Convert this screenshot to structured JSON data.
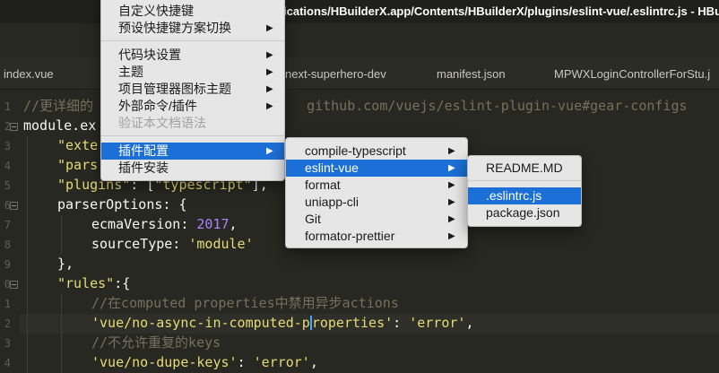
{
  "window": {
    "title": "...Applications/HBuilderX.app/Contents/HBuilderX/plugins/eslint-vue/.eslintrc.js - HBuilderX",
    "title_visible": "ications/HBuilderX.app/Contents/HBuilderX/plugins/eslint-vue/.eslintrc.js - HBuild"
  },
  "tabs": [
    {
      "label": "index.vue"
    },
    {
      "label": "next-superhero-dev"
    },
    {
      "label": "manifest.json"
    },
    {
      "label": "MPWXLoginControllerForStu.j"
    }
  ],
  "gutter": {
    "line_numbers": [
      "1",
      "2",
      "3",
      "4",
      "5",
      "6",
      "7",
      "8",
      "9",
      "0",
      "1",
      "2",
      "3",
      "4"
    ]
  },
  "code": {
    "l1_comment": "//更详细的",
    "l1_rest": "github.com/vuejs/eslint-plugin-vue#gear-configs",
    "l2_start": "module.ex",
    "l3_str": "\"exte",
    "l4_str": "\"pars",
    "l5_key": "\"plugins\"",
    "l5_colon": ": [",
    "l5_val": "\"typescript\"",
    "l5_end": "],",
    "l6": "parserOptions: {",
    "l7_key": "ecmaVersion: ",
    "l7_num": "2017",
    "l7_end": ",",
    "l8_key": "sourceType: ",
    "l8_str": "'module'",
    "l9": "},",
    "l10_key": "\"rules\"",
    "l10_end": ":{",
    "l11_comment": "//在computed properties中禁用异步actions",
    "l12_str_a": "'vue/no-async-in-computed-p",
    "l12_str_b": "roperties'",
    "l12_mid": ": ",
    "l12_val": "'error'",
    "l12_end": ",",
    "l13_comment": "//不允许重复的keys",
    "l14_str": "'vue/no-dupe-keys'",
    "l14_mid": ": ",
    "l14_val": "'error'",
    "l14_end": ","
  },
  "menu_main": {
    "items": [
      {
        "label": "自定义快捷键",
        "has_submenu": false,
        "disabled": false
      },
      {
        "label": "预设快捷键方案切换",
        "has_submenu": true,
        "disabled": false
      },
      {
        "label": "代码块设置",
        "has_submenu": true,
        "disabled": false
      },
      {
        "label": "主题",
        "has_submenu": true,
        "disabled": false
      },
      {
        "label": "项目管理器图标主题",
        "has_submenu": true,
        "disabled": false
      },
      {
        "label": "外部命令/插件",
        "has_submenu": true,
        "disabled": false
      },
      {
        "label": "验证本文档语法",
        "has_submenu": false,
        "disabled": true
      },
      {
        "label": "插件配置",
        "has_submenu": true,
        "selected": true
      },
      {
        "label": "插件安装",
        "has_submenu": false,
        "disabled": false
      }
    ]
  },
  "menu_plugins": {
    "items": [
      {
        "label": "compile-typescript",
        "selected": false
      },
      {
        "label": "eslint-vue",
        "selected": true
      },
      {
        "label": "format",
        "selected": false
      },
      {
        "label": "uniapp-cli",
        "selected": false
      },
      {
        "label": "Git",
        "selected": false
      },
      {
        "label": "formator-prettier",
        "selected": false
      }
    ]
  },
  "menu_files": {
    "items": [
      {
        "label": "README.MD",
        "selected": false
      },
      {
        "label": ".eslintrc.js",
        "selected": true
      },
      {
        "label": "package.json",
        "selected": false
      }
    ]
  },
  "icons": {
    "submenu_arrow": "▶"
  },
  "colors": {
    "selection": "#1c6fd6",
    "editor_bg": "#272822",
    "menu_bg": "#e6e6e6"
  }
}
